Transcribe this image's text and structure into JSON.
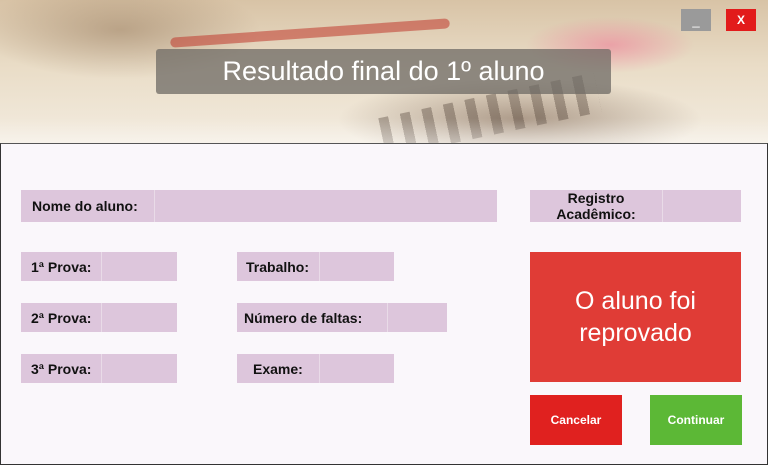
{
  "window": {
    "title": "Resultado final do 1º aluno",
    "minimize_label": "_",
    "close_label": "X"
  },
  "form": {
    "nome_label": "Nome do aluno:",
    "nome_value": "",
    "registro_label": "Registro Acadêmico:",
    "registro_value": "",
    "prova1_label": "1ª Prova:",
    "prova1_value": "",
    "prova2_label": "2ª Prova:",
    "prova2_value": "",
    "prova3_label": "3ª Prova:",
    "prova3_value": "",
    "trabalho_label": "Trabalho:",
    "trabalho_value": "",
    "faltas_label": "Número de faltas:",
    "faltas_value": "",
    "exame_label": "Exame:",
    "exame_value": ""
  },
  "result": {
    "text": "O aluno foi reprovado",
    "color": "#e03c36"
  },
  "buttons": {
    "cancel_label": "Cancelar",
    "cancel_color": "#e0211f",
    "continue_label": "Continuar",
    "continue_color": "#5cb836"
  }
}
